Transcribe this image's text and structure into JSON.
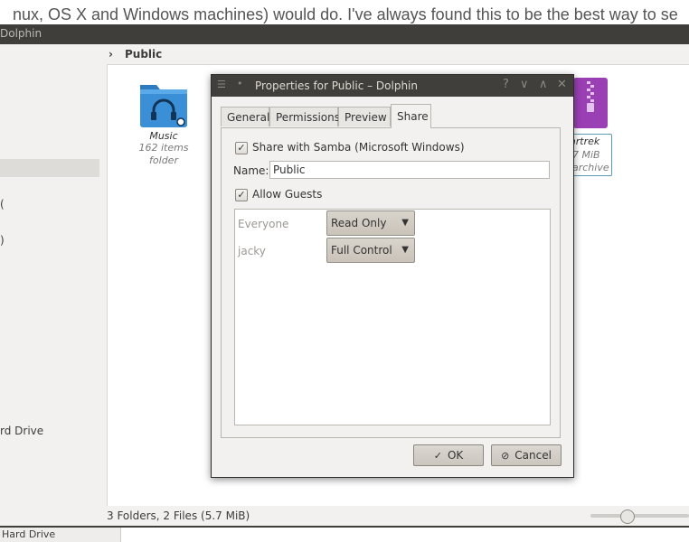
{
  "web_strip": {
    "text": "nux, OS X and Windows machines) would do. I've always found this to be the best way to se"
  },
  "dolphin": {
    "title": "Dolphin",
    "breadcrumb": "Public",
    "places": [
      {
        "label": "("
      },
      {
        "label": ")"
      },
      {
        "label": "rd Drive"
      }
    ],
    "files": [
      {
        "name": "Music",
        "line2": "162 items",
        "line3": "folder"
      },
      {
        "name": "artrek",
        "line2": "7 MiB",
        "line3": "archive"
      }
    ],
    "status": "3 Folders, 2 Files (5.7 MiB)",
    "bottom_place": "Hard Drive",
    "zoom_level": 0.37
  },
  "dialog": {
    "title": "Properties for Public – Dolphin",
    "controls": {
      "help": "?",
      "minimize": "∨",
      "maximize": "∧",
      "close": "✕"
    },
    "tabs": [
      "General",
      "Permissions",
      "Preview",
      "Share"
    ],
    "active_tab": "Share",
    "share_samba": {
      "label": "Share with Samba (Microsoft Windows)",
      "checked": true
    },
    "name_label": "Name:",
    "name_value": "Public",
    "allow_guests": {
      "label": "Allow Guests",
      "checked": true
    },
    "permissions": [
      {
        "user": "Everyone",
        "access": "Read Only"
      },
      {
        "user": "jacky",
        "access": "Full Control"
      }
    ],
    "ok_label": "OK",
    "cancel_label": "Cancel"
  },
  "colors": {
    "titlebar": "#3f3e3b",
    "folder_blue": "#3a8fd6",
    "archive_purple": "#9b3fb5",
    "select_border": "#5a9bb5"
  }
}
